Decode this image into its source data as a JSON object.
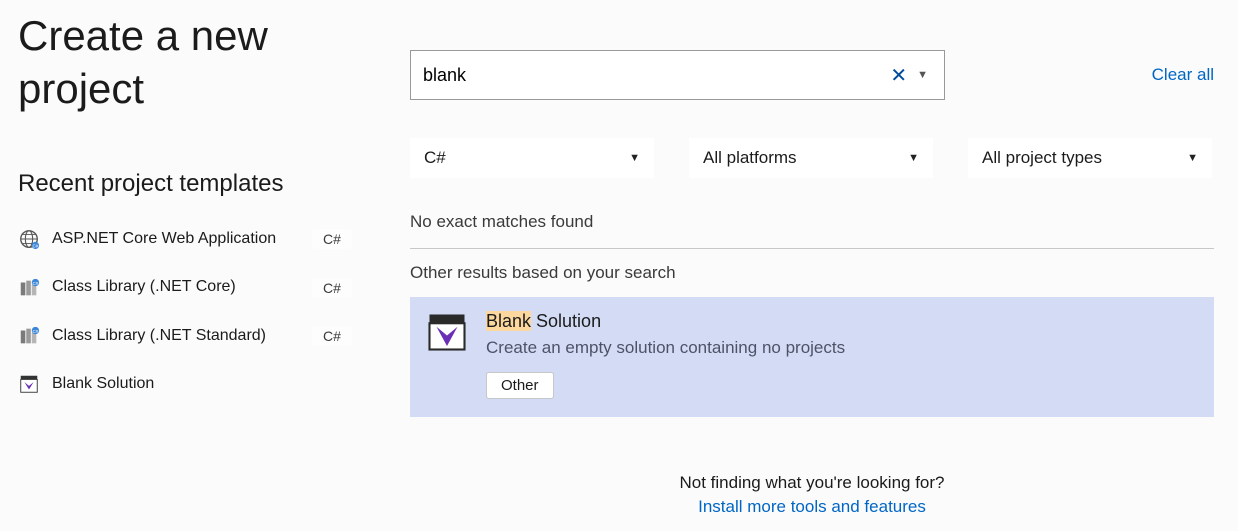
{
  "page_title": "Create a new project",
  "recent_heading": "Recent project templates",
  "recent_items": [
    {
      "label": "ASP.NET Core Web Application",
      "tag": "C#",
      "icon": "globe"
    },
    {
      "label": "Class Library (.NET Core)",
      "tag": "C#",
      "icon": "library"
    },
    {
      "label": "Class Library (.NET Standard)",
      "tag": "C#",
      "icon": "library"
    },
    {
      "label": "Blank Solution",
      "tag": "",
      "icon": "solution"
    }
  ],
  "search": {
    "value": "blank"
  },
  "clear_all": "Clear all",
  "filters": {
    "language": "C#",
    "platform": "All platforms",
    "project_type": "All project types"
  },
  "no_match": "No exact matches found",
  "other_heading": "Other results based on your search",
  "result": {
    "title_highlight": "Blank",
    "title_rest": " Solution",
    "description": "Create an empty solution containing no projects",
    "tag": "Other"
  },
  "footer": {
    "question": "Not finding what you're looking for?",
    "link": "Install more tools and features"
  }
}
